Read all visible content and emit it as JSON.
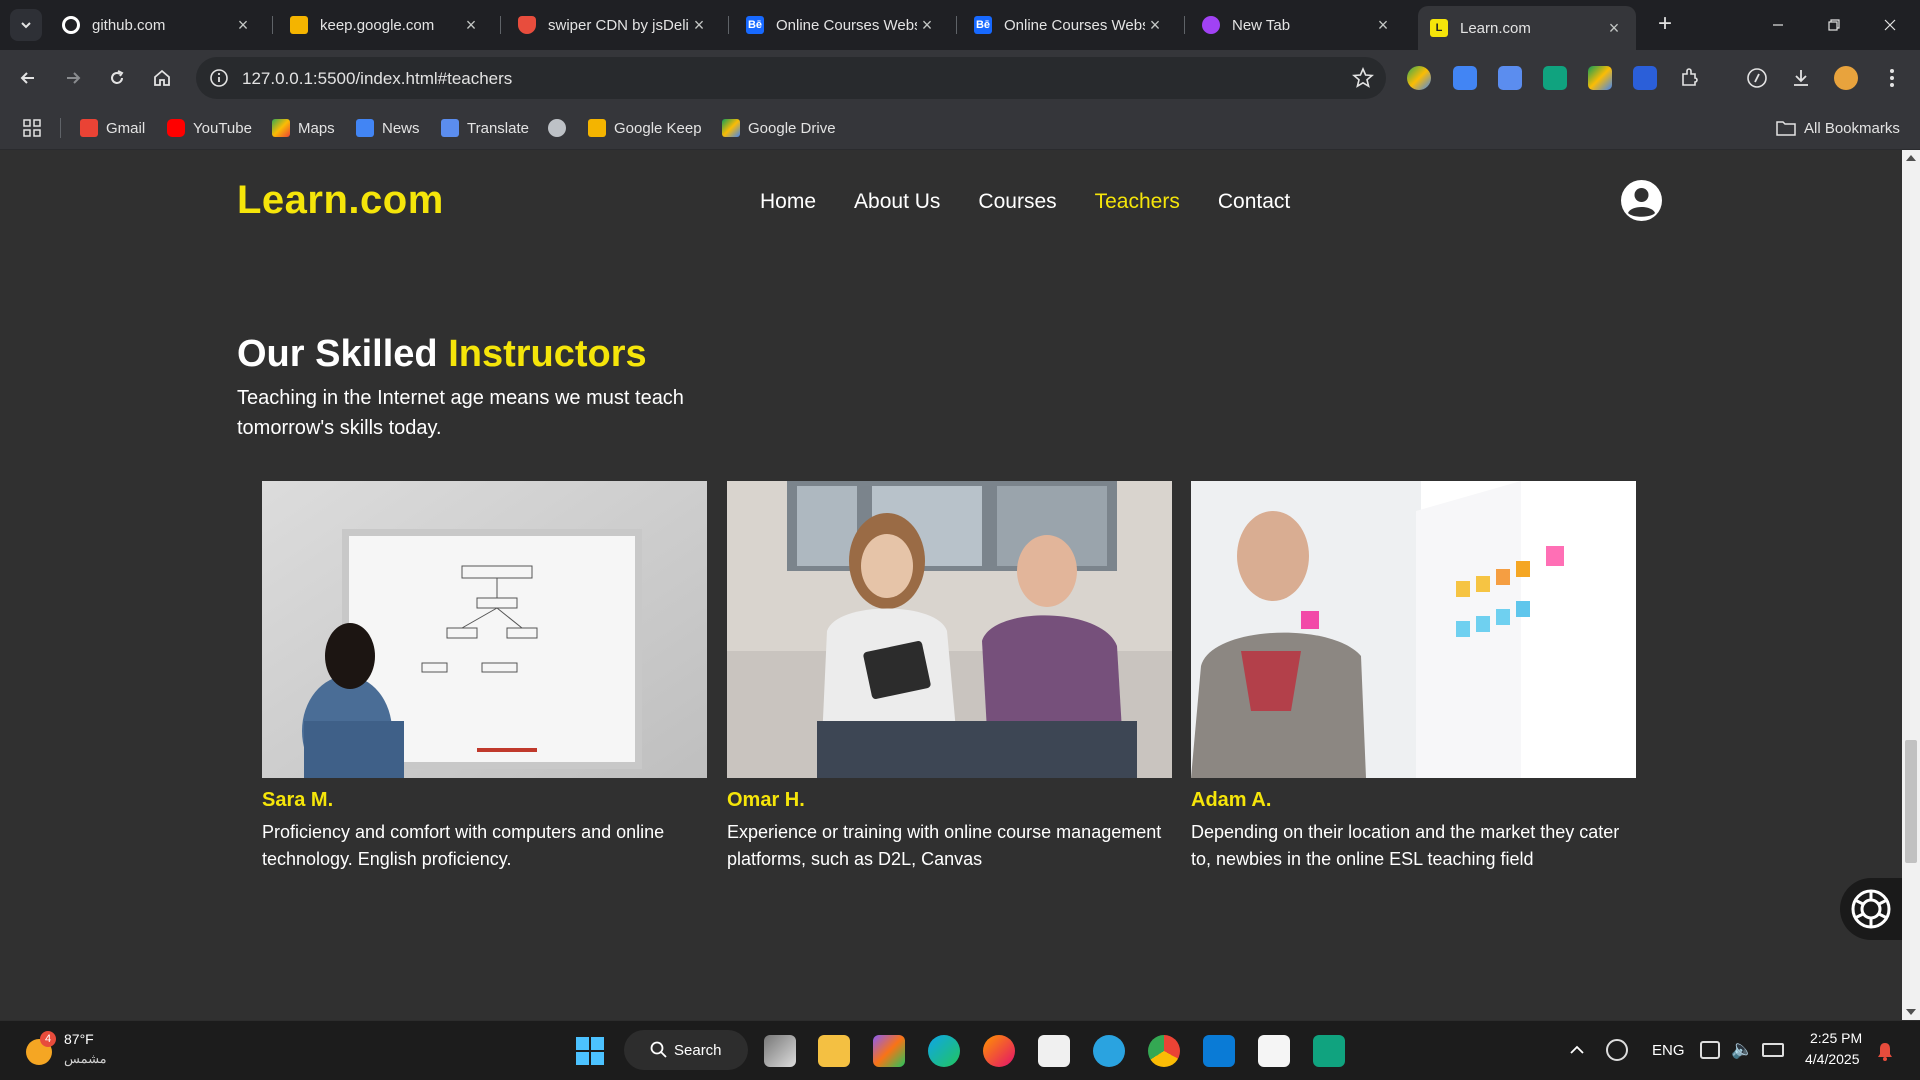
{
  "browser": {
    "tabs": [
      {
        "title": "github.com",
        "favicon": "github-icon",
        "color": "#ffffff"
      },
      {
        "title": "keep.google.com",
        "favicon": "google-keep-icon",
        "color": "#f4b400"
      },
      {
        "title": "swiper CDN by jsDelivr",
        "favicon": "jsdelivr-icon",
        "color": "#e84d3d"
      },
      {
        "title": "Online Courses Website",
        "favicon": "behance-icon",
        "color": "#1769ff"
      },
      {
        "title": "Online Courses Website",
        "favicon": "behance-icon",
        "color": "#1769ff"
      },
      {
        "title": "New Tab",
        "favicon": "new-tab-icon",
        "color": "#a142f4"
      },
      {
        "title": "Learn.com",
        "favicon": "learn-icon",
        "color": "#f5e50a"
      }
    ],
    "url": "127.0.0.1:5500/index.html#teachers",
    "bookmarks": [
      {
        "label": "Gmail",
        "icon": "gmail-icon"
      },
      {
        "label": "YouTube",
        "icon": "youtube-icon"
      },
      {
        "label": "Maps",
        "icon": "maps-icon"
      },
      {
        "label": "News",
        "icon": "news-icon"
      },
      {
        "label": "Translate",
        "icon": "translate-icon"
      },
      {
        "label": "",
        "icon": "globe-icon"
      },
      {
        "label": "Google Keep",
        "icon": "google-keep-icon"
      },
      {
        "label": "Google Drive",
        "icon": "google-drive-icon"
      }
    ],
    "all_bookmarks": "All Bookmarks"
  },
  "site": {
    "logo": "Learn.com",
    "nav": [
      "Home",
      "About Us",
      "Courses",
      "Teachers",
      "Contact"
    ],
    "active_nav": "Teachers",
    "section_title_part1": "Our Skilled",
    "section_title_part2": "Instructors",
    "section_subtitle": "Teaching in the Internet age means we must teach tomorrow's skills today.",
    "teachers": [
      {
        "name": "Sara M.",
        "description": "Proficiency and comfort with computers and online technology. English proficiency."
      },
      {
        "name": "Omar H.",
        "description": "Experience or training with online course management platforms, such as D2L, Canvas"
      },
      {
        "name": "Adam A.",
        "description": "Depending on their location and the market they cater to, newbies in the online ESL teaching field"
      }
    ],
    "accent_color": "#f5e50a"
  },
  "taskbar": {
    "weather_badge": "4",
    "weather_temp": "87°F",
    "weather_desc": "مشمس",
    "search_label": "Search",
    "language": "ENG",
    "time": "2:25 PM",
    "date": "4/4/2025"
  }
}
